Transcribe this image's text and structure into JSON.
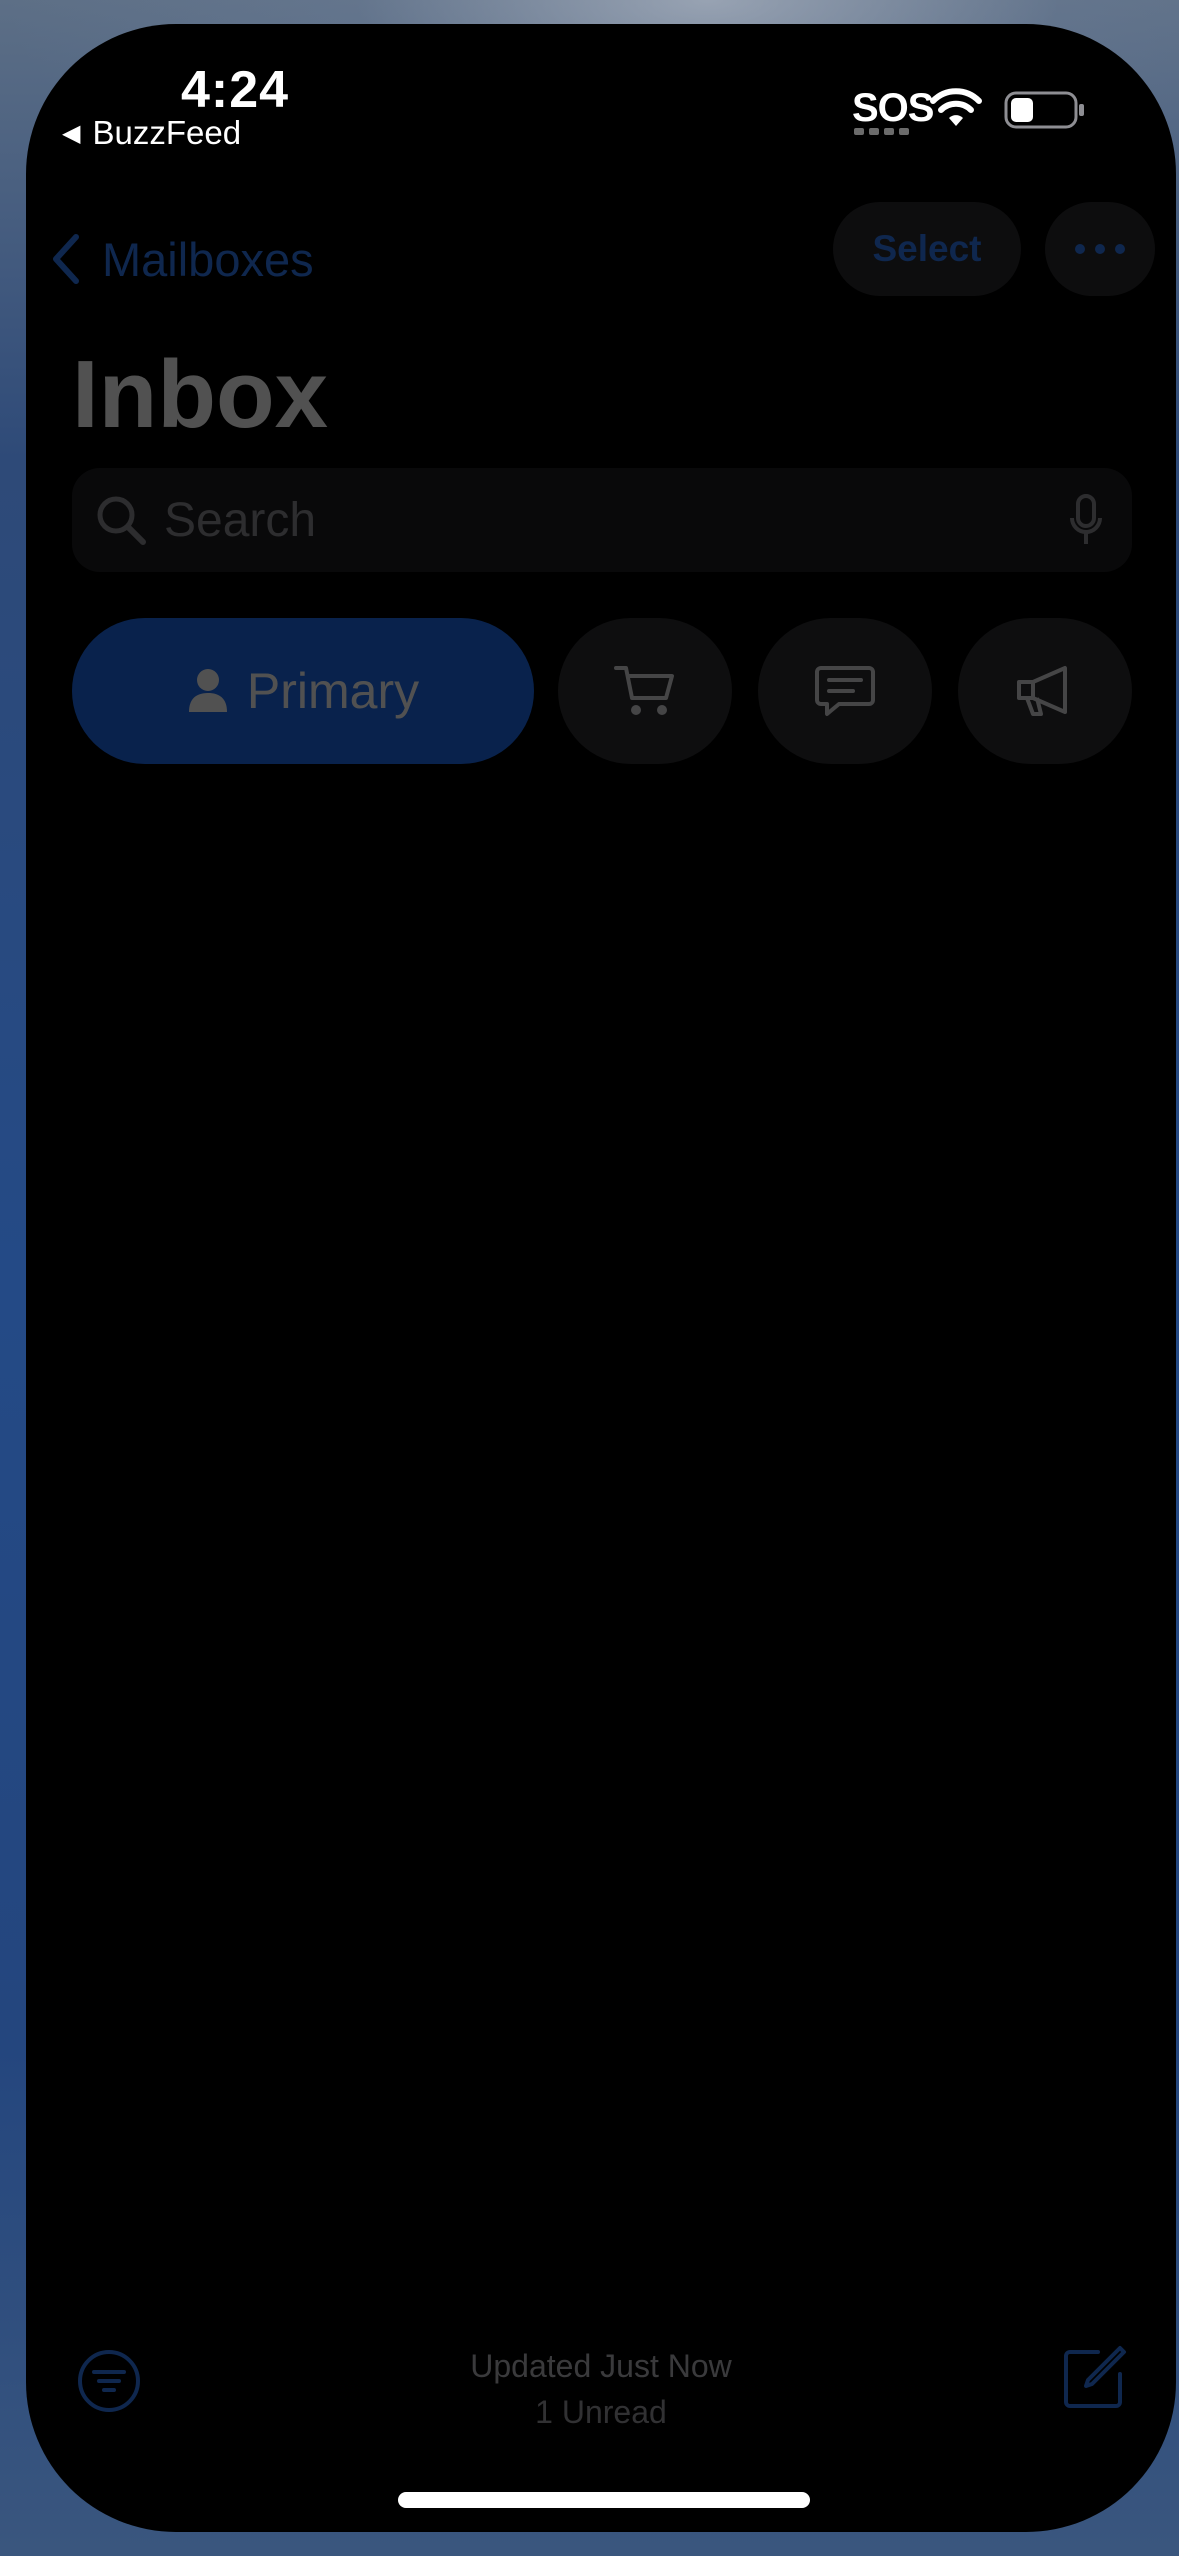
{
  "status_bar": {
    "time": "4:24",
    "back_app": "BuzzFeed",
    "sos": "SOS"
  },
  "nav": {
    "back_label": "Mailboxes",
    "select_label": "Select"
  },
  "page": {
    "title": "Inbox"
  },
  "search": {
    "placeholder": "Search"
  },
  "categories": {
    "primary_label": "Primary",
    "icons": [
      "person-icon",
      "cart-icon",
      "chat-bubble-icon",
      "megaphone-icon"
    ]
  },
  "bottom_bar": {
    "updated": "Updated Just Now",
    "unread": "1 Unread"
  },
  "colors": {
    "accent": "#2f7cf6",
    "background": "#000000"
  }
}
